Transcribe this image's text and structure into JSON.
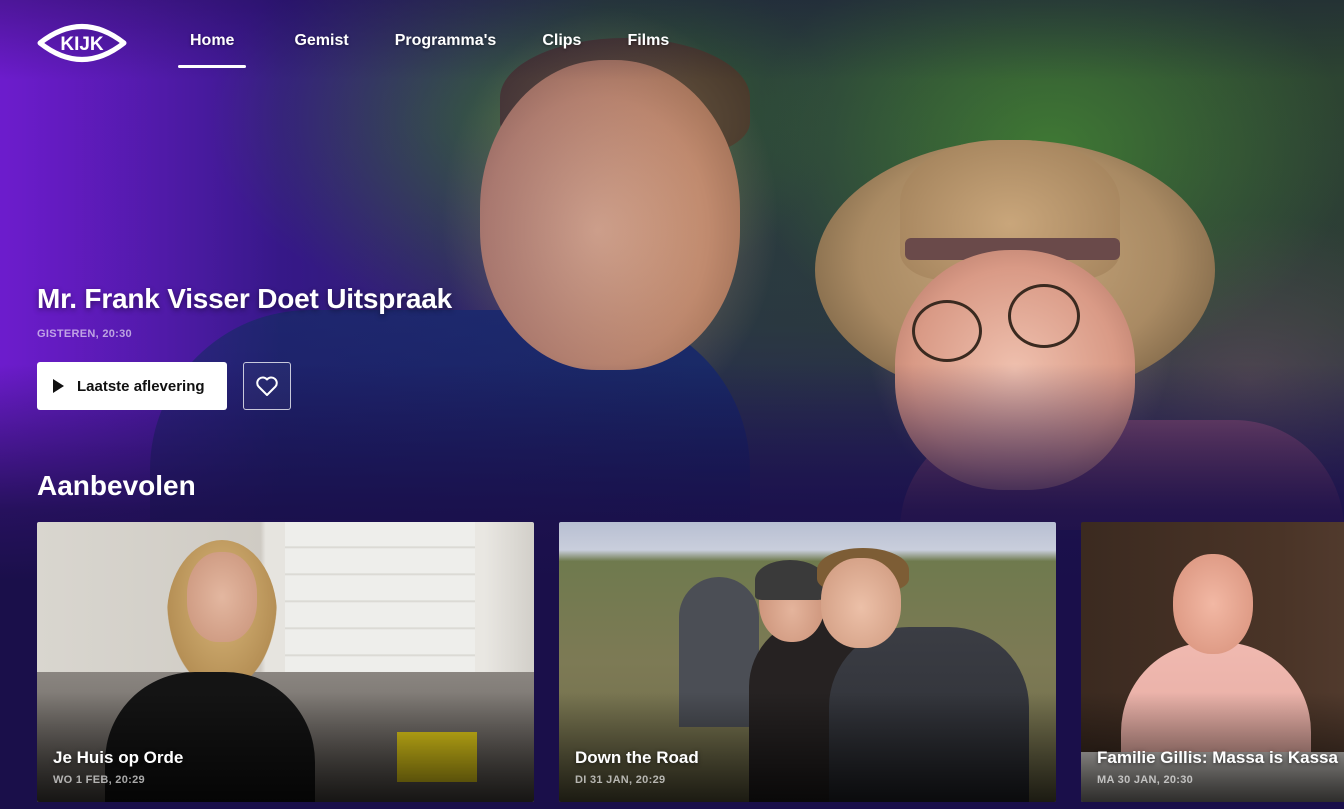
{
  "brand": {
    "logo_text": "KIJK"
  },
  "nav": {
    "items": [
      {
        "label": "Home",
        "active": true
      },
      {
        "label": "Gemist",
        "active": false
      },
      {
        "label": "Programma's",
        "active": false
      },
      {
        "label": "Clips",
        "active": false
      },
      {
        "label": "Films",
        "active": false
      }
    ]
  },
  "hero": {
    "title": "Mr. Frank Visser Doet Uitspraak",
    "meta": "GISTEREN, 20:30",
    "play_label": "Laatste aflevering",
    "favorite_icon": "heart-icon"
  },
  "section": {
    "title": "Aanbevolen",
    "cards": [
      {
        "title": "Je Huis op Orde",
        "meta": "WO 1 FEB, 20:29"
      },
      {
        "title": "Down the Road",
        "meta": "DI 31 JAN, 20:29"
      },
      {
        "title": "Familie Gillis: Massa is Kassa",
        "meta": "MA 30 JAN, 20:30"
      }
    ]
  },
  "colors": {
    "background": "#1a0f4a",
    "accent_purple": "#6b1fc6",
    "text": "#ffffff"
  }
}
